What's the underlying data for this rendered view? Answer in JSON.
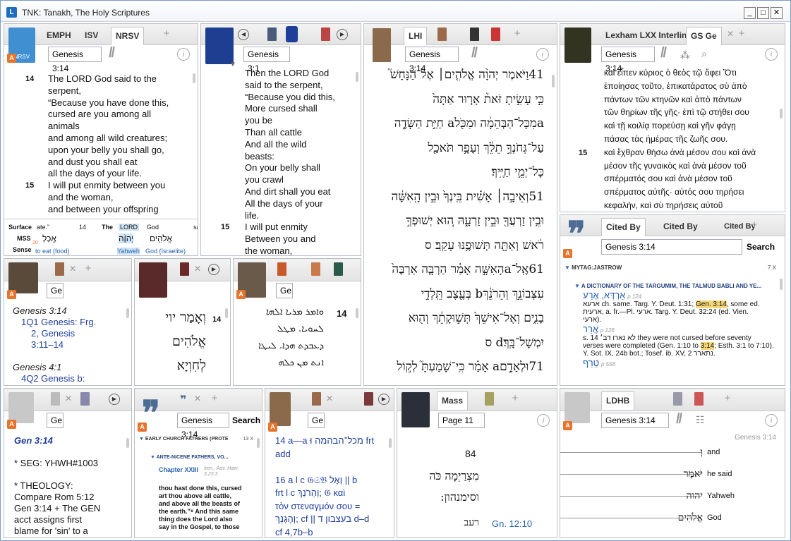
{
  "window": {
    "title": "TNK: Tanakh, The Holy Scriptures",
    "min": "_",
    "max": "□",
    "close": "✕"
  },
  "p1": {
    "tabs": [
      "EMPH",
      "ISV",
      "NRSV"
    ],
    "logo": "NRSV",
    "ref": "Genesis 3:14",
    "lines": [
      [
        "14",
        "The LORD God said to the"
      ],
      [
        "",
        "serpent,"
      ],
      [
        "",
        "“Because you have done this,"
      ],
      [
        "",
        "cursed are you among all"
      ],
      [
        "",
        "animals"
      ],
      [
        "",
        "and among all wild creatures;"
      ],
      [
        "",
        "upon your belly you shall go,"
      ],
      [
        "",
        "and dust you shall eat"
      ],
      [
        "",
        "all the days of your life."
      ],
      [
        "15",
        "I will put enmity between you"
      ],
      [
        "",
        "and the woman,"
      ],
      [
        "",
        "and between your offspring"
      ]
    ],
    "interlinear": {
      "labels": [
        "Surface",
        "MSS",
        "Sense"
      ],
      "surface": [
        "ate.”",
        "14",
        "The",
        "LORD",
        "God",
        "sa"
      ],
      "mss": [
        "אָֽכַלְ",
        "20",
        "14",
        "יְהוָ֨ה",
        "אֱלֹהִ֤ים"
      ],
      "sense": [
        "to eat (food)",
        "Yahweh",
        "God (Israelite)"
      ]
    }
  },
  "p2": {
    "ref": "Genesis 3:1",
    "lines": [
      [
        "",
        "Then the LORD God"
      ],
      [
        "",
        "said to the serpent,"
      ],
      [
        "",
        "“Because you did this,"
      ],
      [
        "",
        "More cursed shall"
      ],
      [
        "",
        "you be"
      ],
      [
        "",
        "Than all cattle"
      ],
      [
        "",
        "And all the wild"
      ],
      [
        "",
        "beasts:"
      ],
      [
        "",
        "On your belly shall"
      ],
      [
        "",
        "you crawl"
      ],
      [
        "",
        "And dirt shall you eat"
      ],
      [
        "",
        "All the days of your"
      ],
      [
        "",
        "life."
      ],
      [
        "15",
        "I will put enmity"
      ],
      [
        "",
        "Between you and"
      ],
      [
        "",
        "the woman,"
      ]
    ]
  },
  "p3": {
    "tab": "LHI",
    "ref": "Genesis 3:14",
    "lines": [
      "14וַיֹּאמֶר יְהוָ֨ה אֱלֹהִ֤ים׀ אֶל־הַנָּחָשׁ֮",
      "כִּ֣י עָשִׂ֣יתָ זֹּאת֒ אָר֤וּר אַתָּה֙",
      "aמִכָּל־הַבְּהֵמָ֔ה וּמִכֹּ֖לa חַיַּ֣ת הַשָּׂדֶ֑ה",
      "עַל־גְּחֹנְךָ֣ תֵלֵ֔ךְ וְעָפָ֥ר תֹּאכַ֖ל",
      "כָּל־יְמֵ֥י חַיֶּֽיךָ׃",
      "15וְאֵיבָ֣ה׀ אָשִׁ֗ית בֵּֽינְךָ֙ וּבֵ֣ין הָֽאִשָּׁ֔ה",
      "וּבֵ֥ין זַרְעֲךָ֖ וּבֵ֣ין זַרְעָ֑הּ ה֚וּא יְשׁוּפְךָ֣",
      "רֹ֔אשׁ וְאַתָּ֖ה תְּשׁוּפֶ֥נּוּ עָקֵֽב׃ ס",
      "16אֶֽל־aהָאִשָּׁ֣ה אָמַ֗ר הַרְבָּ֤ה אַרְבֶּה֙",
      "עִצְּבוֹנֵ֣ךְ וְהֵרֹנֵ֔ךְb בְּעֶ֖צֶב תֵּֽלְדִ֣י",
      "בָנִ֑ים וְאֶל־אִישֵׁךְ֙ תְּשׁ֣וּקָתֵ֔ךְ וְה֖וּא",
      "יִמְשָׁל־בָּֽךְ׃d ס",
      "17וּלְאָדָ֣םa אָמַ֗ר כִּֽי־שָׁמַעְתָּ֮ לְק֣וֹל"
    ]
  },
  "p4": {
    "tabs": [
      "Lexham LXX Interlinear",
      "GS Ge"
    ],
    "ref": "Genesis 3:14",
    "lines": [
      [
        "",
        "καὶ εἶπεν κύριος ὁ θεὸς τῷ ὄφει Ὅτι"
      ],
      [
        "",
        "ἐποίησας τοῦτο, ἐπικατάρατος σὺ ἀπὸ"
      ],
      [
        "",
        "πάντων τῶν κτηνῶν καὶ ἀπὸ πάντων"
      ],
      [
        "",
        "τῶν θηρίων τῆς γῆς· ἐπὶ τῷ στήθει σου"
      ],
      [
        "",
        "καὶ τῇ κοιλίᾳ πορεύσῃ καὶ γῆν φάγῃ"
      ],
      [
        "",
        "πάσας τὰς ἡμέρας τῆς ζωῆς σου."
      ],
      [
        "15",
        "καὶ ἔχθραν θήσω ἀνὰ μέσον σου καὶ ἀνὰ"
      ],
      [
        "",
        "μέσον τῆς γυναικὸς καὶ ἀνὰ μέσον τοῦ"
      ],
      [
        "",
        "σπέρματός σου καὶ ἀνὰ μέσον τοῦ"
      ],
      [
        "",
        "σπέρματος αὐτῆς· αὐτός σου τηρήσει"
      ],
      [
        "",
        "κεφαλήν, καὶ σὺ τηρήσεις αὐτοῦ"
      ]
    ]
  },
  "p5": {
    "tabs": [
      "Cited By",
      "Cited By",
      "Cited By"
    ],
    "ref": "Genesis 3:14",
    "search": "Search",
    "group": "MYTAG:JASTROW",
    "count": "7 X",
    "book": "A DICTIONARY OF THE TARGUMIM, THE TALMUD BABLI AND YE...",
    "e1head": "אַרְדְּא, אֲרַע",
    "e1page": "p 124",
    "e1a": "ארעא ch. same. Targ. Y. Deut. 1:31;",
    "e1hl": "Gen. 3:14",
    "e1b": ", some ed.",
    "e1c": "ארעית, a. fr.—Pl. ארעי. Targ. Y. Deut. 32:24 (ed. Vien.",
    "e1d": "ארעי).",
    "e2head": "אֲרַר",
    "e2page": "p 126",
    "e2a": "s. 14 לא נארו דב׳ they were not cursed before seventy",
    "e2b": "verses were completed (Gen. 1:10 to",
    "e2hl": "3:14",
    "e2c": "; Esth. 3:1 to 7:10).",
    "e2d": "Y. Sot. IX, 24b bot.; Tosef. ib. XV, 2 נתארר.",
    "e3head": "טְרַף",
    "e3page": "p 556"
  },
  "p6": {
    "ref": "Ge",
    "lines": [
      [
        "",
        "Genesis 3:14"
      ],
      [
        "",
        "1Q1 Genesis: Frg."
      ],
      [
        "",
        "2, Genesis"
      ],
      [
        "",
        "3:11–14"
      ],
      [
        "",
        ""
      ],
      [
        "",
        "Genesis 4:1"
      ],
      [
        "",
        "4Q2 Genesis b:"
      ]
    ]
  },
  "p7": {
    "num": "14",
    "lines": [
      "וְאָמַר יוי",
      "אֱלֹהִים",
      "לְחִוְיָא"
    ]
  },
  "p8": {
    "ref": "Ge",
    "num": "14",
    "lines": [
      "ܘܐܡܪ ܡܪܝܐ ܐܠܗܐ",
      "ܠܚܘܝܐ. ܡܛܠ",
      "ܕܥܒܕܬ ܗܕܐ. ܠܝܛܐ",
      "ܐܢܬ ܡܢ ܟܠܗ"
    ]
  },
  "p9": {
    "ref": "Ge",
    "lines": [
      "Gen 3:14",
      "",
      "* SEG: YHWH#1003",
      "",
      "* THEOLOGY:",
      "Compare Rom 5:12",
      "Gen 3:14 + The GEN",
      "acct assigns first",
      "blame for 'sin' to a",
      "literal snake. I'd"
    ]
  },
  "p10": {
    "ref": "Genesis 3:14",
    "search": "Search",
    "group": "EARLY CHURCH FATHERS (PROTE",
    "count": "13 X",
    "sub": "ANTE-NICENE FATHERS, VO...",
    "chapter": "Chapter XXIII",
    "cite": "Iren., Adv. Haer. 3.23.3",
    "body": [
      "thou hast done this, cursed",
      "art thou above all cattle,",
      "and above all the beasts of",
      "the earth.”⁸ And this same",
      "thing does the Lord also",
      "say in the Gospel, to those"
    ]
  },
  "p11": {
    "ref": "Ge",
    "lines": [
      "14 a—a מכל־הבהמה וּ frt",
      "add",
      "",
      "16 a l c 𝔊𝔖𝔅 וְאֶל || b",
      "frt l c וְהֵרֹנֵךְ; 𝔊 καὶ",
      "τὸν στεναγμόν σου =",
      "וְהֶגְנֵךְ; cf || בעצבון ד d–d",
      "cf 4,7b–b"
    ]
  },
  "p12": {
    "tab": "Mass",
    "ref": "Page 11",
    "num": "84",
    "heb1": "מִצְרַיְמָה כֹּה",
    "heb2": "וסימנהון:",
    "heb3": "רעב",
    "link": "Gn. 12:10"
  },
  "p13": {
    "tab": "LDHB",
    "ref": "Genesis 3:14",
    "head": "Genesis 3:14",
    "rows": [
      [
        "וְ",
        "and"
      ],
      [
        "יֹּאמֶר",
        "he said"
      ],
      [
        "יהוה",
        "Yahweh"
      ],
      [
        "אֱלֹהִים",
        "God"
      ]
    ]
  }
}
